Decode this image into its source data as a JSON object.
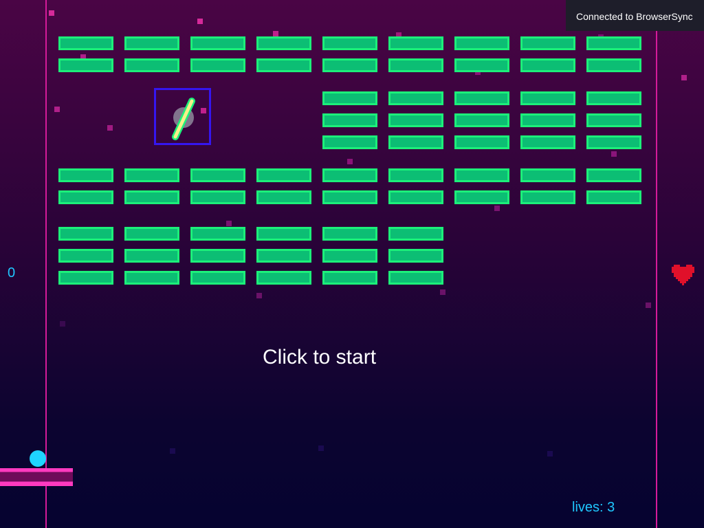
{
  "hud": {
    "score": "0",
    "lives_label": "lives: 3",
    "start_prompt": "Click to start"
  },
  "notification": {
    "text": "Connected to BrowserSync"
  },
  "icons": {
    "powerup": "laser-powerup-icon",
    "life": "heart-icon"
  },
  "colors": {
    "brick_fill": "#0cbe74",
    "brick_border": "#1cf07a",
    "wall": "#d61a9a",
    "paddle": "#ff3ac0",
    "ball": "#1fd4ff",
    "hud_text": "#1fc7ff",
    "heart": "#e0102a",
    "powerup_frame": "#3516f0"
  },
  "bricks": {
    "rows": [
      [
        1,
        1,
        1,
        1,
        1,
        1,
        1,
        1,
        1
      ],
      [
        1,
        1,
        1,
        1,
        1,
        1,
        1,
        1,
        1
      ],
      [
        0,
        0,
        0,
        0,
        1,
        1,
        1,
        1,
        1
      ],
      [
        0,
        0,
        0,
        0,
        1,
        1,
        1,
        1,
        1
      ],
      [
        0,
        0,
        0,
        0,
        1,
        1,
        1,
        1,
        1
      ],
      [
        1,
        1,
        1,
        1,
        1,
        1,
        1,
        1,
        1
      ],
      [
        1,
        1,
        1,
        1,
        1,
        1,
        1,
        1,
        1
      ],
      [
        1,
        1,
        1,
        1,
        1,
        1,
        0,
        0,
        0
      ],
      [
        1,
        1,
        1,
        1,
        1,
        1,
        0,
        0,
        0
      ],
      [
        1,
        1,
        1,
        1,
        1,
        1,
        0,
        0,
        0
      ]
    ]
  }
}
